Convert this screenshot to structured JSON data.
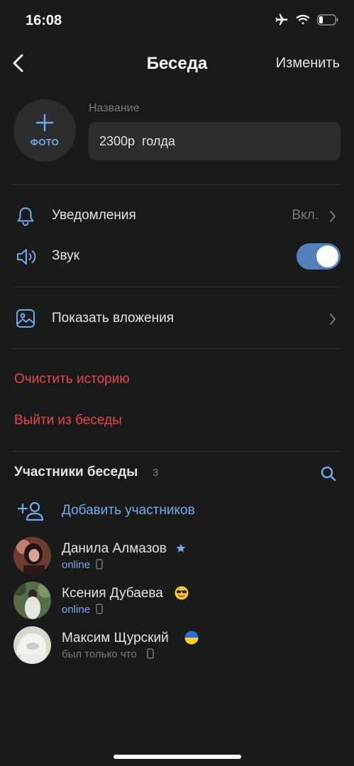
{
  "status_bar": {
    "time": "16:08"
  },
  "nav": {
    "title": "Беседа",
    "edit": "Изменить"
  },
  "chat": {
    "photo_label": "ФОТО",
    "name_label": "Название",
    "name_value": "2300р  голда"
  },
  "settings": {
    "notifications": {
      "label": "Уведомления",
      "value": "Вкл."
    },
    "sound": {
      "label": "Звук",
      "enabled": true
    },
    "attachments": {
      "label": "Показать вложения"
    }
  },
  "actions": {
    "clear_history": "Очистить историю",
    "leave_chat": "Выйти из беседы"
  },
  "members": {
    "title": "Участники беседы",
    "count": "3",
    "add_label": "Добавить участников",
    "list": [
      {
        "name": "Данила Алмазов",
        "status": "online",
        "badge": "star-icon"
      },
      {
        "name": "Ксения Дубаева",
        "status": "online",
        "badge": "sunglasses-emoji"
      },
      {
        "name": "Максим Щурский",
        "status": "был только что",
        "badge": "ukraine-flag"
      }
    ]
  },
  "colors": {
    "accent": "#71aaeb",
    "danger": "#e64646",
    "toggle": "#5181b8",
    "background": "#1a1a1a"
  }
}
